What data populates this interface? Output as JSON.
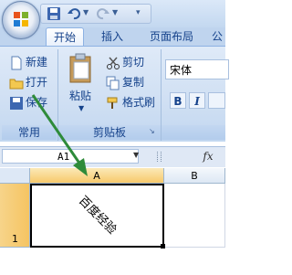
{
  "tabs": [
    {
      "label": "开始",
      "active": true
    },
    {
      "label": "插入",
      "active": false
    },
    {
      "label": "页面布局",
      "active": false
    },
    {
      "label": "公",
      "active": false
    }
  ],
  "ribbon": {
    "clipboard_left": {
      "new": "新建",
      "open": "打开",
      "save": "保存",
      "group": "常用"
    },
    "clipboard": {
      "paste": "粘贴",
      "cut": "剪切",
      "copy": "复制",
      "format_painter": "格式刷",
      "group": "剪贴板"
    },
    "font": {
      "name": "宋体",
      "bold": "B",
      "italic": "I"
    }
  },
  "formula_bar": {
    "name_box": "A1",
    "fx": "fx"
  },
  "grid": {
    "columns": [
      "A",
      "B"
    ],
    "rows": [
      "1"
    ],
    "a1_value": "百度经验"
  },
  "colors": {
    "accent": "#15428b",
    "arrow": "#2e8b3a",
    "selected_header": "#f7c96b"
  }
}
